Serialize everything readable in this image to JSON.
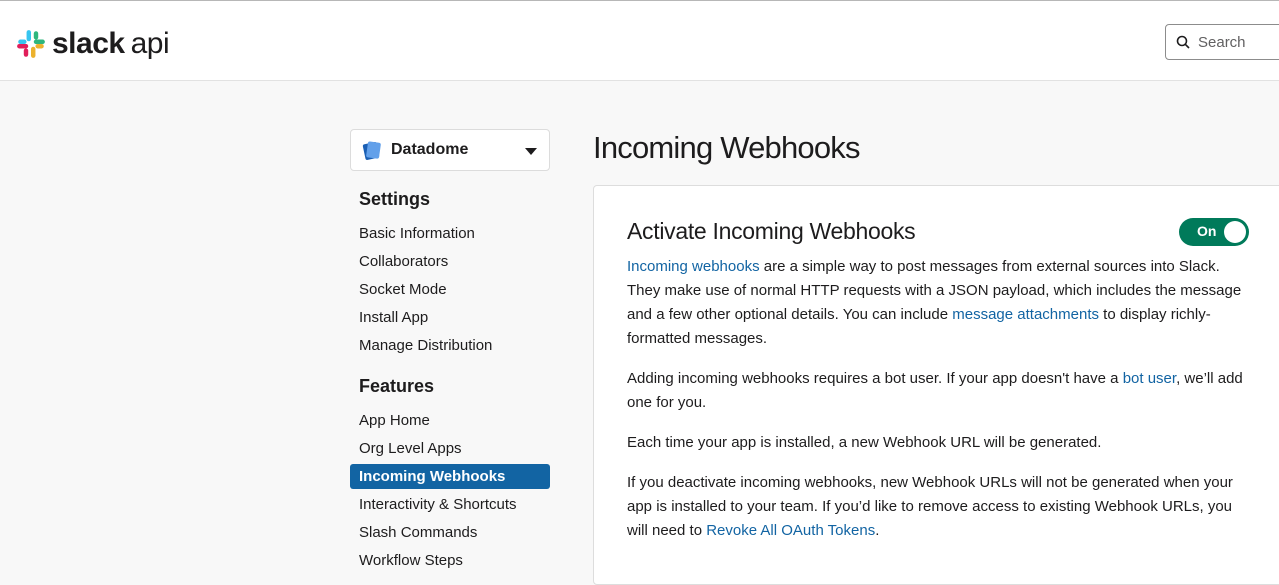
{
  "header": {
    "brand_bold": "slack",
    "brand_light": "api",
    "search_placeholder": "Search"
  },
  "sidebar": {
    "app_name": "Datadome",
    "settings_heading": "Settings",
    "settings_items": [
      {
        "label": "Basic Information"
      },
      {
        "label": "Collaborators"
      },
      {
        "label": "Socket Mode"
      },
      {
        "label": "Install App"
      },
      {
        "label": "Manage Distribution"
      }
    ],
    "features_heading": "Features",
    "features_items": [
      {
        "label": "App Home"
      },
      {
        "label": "Org Level Apps"
      },
      {
        "label": "Incoming Webhooks",
        "active": true
      },
      {
        "label": "Interactivity & Shortcuts"
      },
      {
        "label": "Slash Commands"
      },
      {
        "label": "Workflow Steps"
      }
    ]
  },
  "main": {
    "page_title": "Incoming Webhooks",
    "card_title": "Activate Incoming Webhooks",
    "toggle_label": "On",
    "p1": {
      "link1": "Incoming webhooks",
      "text1": " are a simple way to post messages from external sources into Slack. They make use of normal HTTP requests with a JSON payload, which includes the message and a few other optional details. You can include ",
      "link2": "message attachments",
      "text2": " to display richly-formatted messages."
    },
    "p2": {
      "text1": "Adding incoming webhooks requires a bot user. If your app doesn't have a ",
      "link1": "bot user",
      "text2": ", we’ll add one for you."
    },
    "p3": {
      "text1": "Each time your app is installed, a new Webhook URL will be generated."
    },
    "p4": {
      "text1": "If you deactivate incoming webhooks, new Webhook URLs will not be generated when your app is installed to your team. If you’d like to remove access to existing Webhook URLs, you will need to ",
      "link1": "Revoke All OAuth Tokens",
      "text2": "."
    }
  },
  "colors": {
    "accent": "#1264a3",
    "toggle_on": "#007a5a",
    "slack_blue": "#36c5f0",
    "slack_green": "#2eb67d",
    "slack_yellow": "#ecb22e",
    "slack_red": "#e01e5a"
  }
}
